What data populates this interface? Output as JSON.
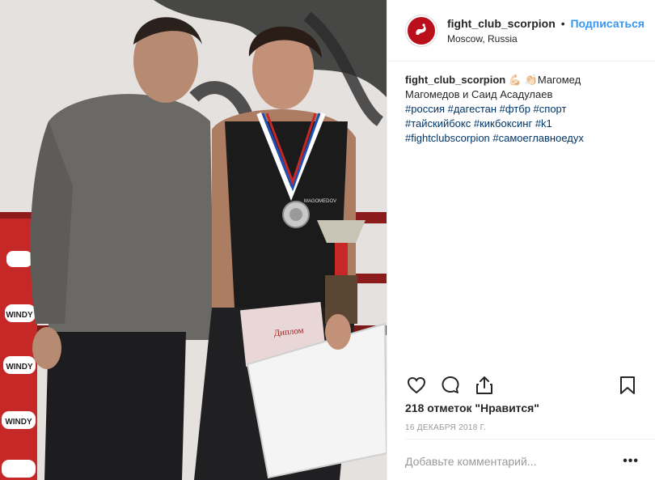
{
  "post": {
    "username": "fight_club_scorpion",
    "separator": "•",
    "follow_label": "Подписаться",
    "location": "Moscow, Russia",
    "caption": {
      "username": "fight_club_scorpion",
      "text_line": "💪🏻 👏🏻Магомед Магомедов и Саид Асадулаев",
      "hashtags_line_1": "#россия #дагестан #фтбр #спорт",
      "hashtags_line_2": "#тайскийбокс #кикбоксинг #k1",
      "hashtags_line_3": "#fightclubscorpion #самоеглавноедух"
    },
    "likes_text": "218 отметок \"Нравится\"",
    "date": "16 декабря 2018 г.",
    "comment_placeholder": "Добавьте комментарий...",
    "more_label": "•••"
  },
  "photo": {
    "banner_brand": "WINDY",
    "diploma_text": "Диплом",
    "vest_text": "MAGOMEDOV"
  },
  "icons": {
    "avatar": "scorpion-logo-icon",
    "like": "heart-icon",
    "comment": "speech-bubble-icon",
    "share": "share-icon",
    "save": "bookmark-icon"
  },
  "colors": {
    "accent": "#3897f0",
    "hashtag": "#003569",
    "brand_red": "#b9101c",
    "muted": "#999999"
  }
}
